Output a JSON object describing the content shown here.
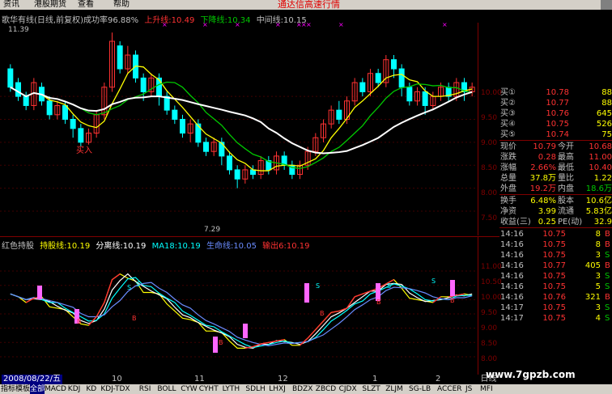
{
  "menu": {
    "items": [
      "资讯",
      "港股期货",
      "查看",
      "帮助"
    ],
    "brand": "通达信高速行情"
  },
  "main_chart": {
    "header": {
      "title": "歌华有线(日线,前复权)",
      "success_rate": "成功率96.88%",
      "up_line": "上升线:10.49",
      "down_line": "下降线:10.34",
      "mid_line": "中间线:10.15"
    },
    "high_label": "11.39",
    "low_label": "7.29",
    "buy_label": "买入",
    "y_ticks": [
      "10.00",
      "9.50",
      "9.00",
      "8.50",
      "8.00",
      "7.50"
    ],
    "colors": {
      "up": "#ff3232",
      "down": "#00ffff",
      "white": "#ffffff",
      "green": "#00c800",
      "yellow": "#ffff00"
    }
  },
  "chart_data": [
    {
      "type": "candlestick",
      "title": "歌华有线(日线,前复权)",
      "ylim": [
        7.2,
        11.5
      ],
      "series": [
        {
          "name": "上升线",
          "values": [
            10.49
          ]
        },
        {
          "name": "下降线",
          "values": [
            10.34
          ]
        },
        {
          "name": "中间线",
          "values": [
            10.15
          ]
        }
      ],
      "candles": [
        [
          10.6,
          10.2,
          10.7,
          10.1
        ],
        [
          10.3,
          10.0,
          10.4,
          9.9
        ],
        [
          10.0,
          9.8,
          10.1,
          9.7
        ],
        [
          9.8,
          10.3,
          10.4,
          9.7
        ],
        [
          10.2,
          9.9,
          10.3,
          9.8
        ],
        [
          9.9,
          9.6,
          10.0,
          9.5
        ],
        [
          9.6,
          9.8,
          9.9,
          9.5
        ],
        [
          9.8,
          9.5,
          9.9,
          9.4
        ],
        [
          9.5,
          9.3,
          9.6,
          9.1
        ],
        [
          9.3,
          9.0,
          9.4,
          8.9
        ],
        [
          9.0,
          9.2,
          9.3,
          8.95
        ],
        [
          9.2,
          9.6,
          9.7,
          9.1
        ],
        [
          9.6,
          10.2,
          10.3,
          9.5
        ],
        [
          10.2,
          11.2,
          11.39,
          10.1
        ],
        [
          11.1,
          10.6,
          11.2,
          10.5
        ],
        [
          10.6,
          10.9,
          11.1,
          10.5
        ],
        [
          10.9,
          10.4,
          11.0,
          10.3
        ],
        [
          10.4,
          10.1,
          10.5,
          9.9
        ],
        [
          10.1,
          10.4,
          10.5,
          10.0
        ],
        [
          10.4,
          10.0,
          10.5,
          9.8
        ],
        [
          10.0,
          9.7,
          10.1,
          9.6
        ],
        [
          9.7,
          9.5,
          9.8,
          9.4
        ],
        [
          9.5,
          9.2,
          9.6,
          9.1
        ],
        [
          9.2,
          9.4,
          9.5,
          9.0
        ],
        [
          9.4,
          9.0,
          9.5,
          8.9
        ],
        [
          9.0,
          8.8,
          9.1,
          8.7
        ],
        [
          8.8,
          9.0,
          9.1,
          8.7
        ],
        [
          9.0,
          8.7,
          9.1,
          8.5
        ],
        [
          8.7,
          8.4,
          8.8,
          8.3
        ],
        [
          8.4,
          8.2,
          8.5,
          8.0
        ],
        [
          8.2,
          8.4,
          8.5,
          8.1
        ],
        [
          8.4,
          8.3,
          8.5,
          8.2
        ],
        [
          8.3,
          8.6,
          8.7,
          8.2
        ],
        [
          8.6,
          8.4,
          8.7,
          8.3
        ],
        [
          8.4,
          8.7,
          8.8,
          8.3
        ],
        [
          8.7,
          8.5,
          8.8,
          8.4
        ],
        [
          8.5,
          8.3,
          8.6,
          8.2
        ],
        [
          8.3,
          8.5,
          8.6,
          8.2
        ],
        [
          8.5,
          8.8,
          8.9,
          8.4
        ],
        [
          8.8,
          9.1,
          9.2,
          8.7
        ],
        [
          9.1,
          9.4,
          9.5,
          9.0
        ],
        [
          9.4,
          9.7,
          9.8,
          9.3
        ],
        [
          9.7,
          9.5,
          9.9,
          9.4
        ],
        [
          9.5,
          9.9,
          10.0,
          9.4
        ],
        [
          9.9,
          10.3,
          10.4,
          9.8
        ],
        [
          10.3,
          10.1,
          10.4,
          10.0
        ],
        [
          10.1,
          10.5,
          10.6,
          10.0
        ],
        [
          10.5,
          10.3,
          10.6,
          10.2
        ],
        [
          10.3,
          10.8,
          10.9,
          10.2
        ],
        [
          10.8,
          10.6,
          10.9,
          10.4
        ],
        [
          10.6,
          10.2,
          10.7,
          10.0
        ],
        [
          10.2,
          9.9,
          10.3,
          9.8
        ],
        [
          9.9,
          10.1,
          10.2,
          9.8
        ],
        [
          10.1,
          9.8,
          10.2,
          9.6
        ],
        [
          9.8,
          10.0,
          10.1,
          9.7
        ],
        [
          10.0,
          10.2,
          10.3,
          9.9
        ],
        [
          10.2,
          10.0,
          10.3,
          9.9
        ],
        [
          10.0,
          10.3,
          10.4,
          9.9
        ],
        [
          10.3,
          10.1,
          10.4,
          9.9
        ],
        [
          10.1,
          10.2,
          10.3,
          10.0
        ]
      ]
    },
    {
      "type": "line",
      "title": "红色持股",
      "ylim": [
        7.8,
        11.2
      ],
      "series": [
        {
          "name": "持股线",
          "values": [
            10.19
          ]
        },
        {
          "name": "分离线",
          "values": [
            10.19
          ]
        },
        {
          "name": "MA18",
          "values": [
            10.19
          ]
        },
        {
          "name": "生命线",
          "values": [
            10.05
          ]
        },
        {
          "name": "输出6",
          "values": [
            10.19
          ]
        }
      ]
    }
  ],
  "sub_chart": {
    "header": {
      "title": "红色持股",
      "hold_line": "持股线:10.19",
      "split_line": "分离线:10.19",
      "ma18": "MA18:10.19",
      "life_line": "生命线:10.05",
      "output6": "输出6:10.19"
    },
    "y_ticks": [
      "11.00",
      "10.50",
      "10.00",
      "9.50",
      "9.00",
      "8.50",
      "8.00"
    ],
    "signal_b": "B",
    "signal_s": "S"
  },
  "panel": {
    "bids": [
      {
        "label": "买①",
        "price": "10.78",
        "vol": "88"
      },
      {
        "label": "买②",
        "price": "10.77",
        "vol": "88"
      },
      {
        "label": "买③",
        "price": "10.76",
        "vol": "645"
      },
      {
        "label": "买④",
        "price": "10.75",
        "vol": "526"
      },
      {
        "label": "买⑤",
        "price": "10.74",
        "vol": "75"
      }
    ],
    "quote": [
      {
        "l1": "现价",
        "v1": "10.79",
        "l2": "今开",
        "v2": "10.68"
      },
      {
        "l1": "涨跌",
        "v1": "0.28",
        "l2": "最高",
        "v2": "11.00"
      },
      {
        "l1": "涨幅",
        "v1": "2.66%",
        "l2": "最低",
        "v2": "10.40"
      },
      {
        "l1": "总量",
        "v1": "37.8万",
        "l2": "量比",
        "v2": "1.22"
      },
      {
        "l1": "外盘",
        "v1": "19.2万",
        "l2": "内盘",
        "v2": "18.6万"
      }
    ],
    "quote2": [
      {
        "l1": "换手",
        "v1": "6.48%",
        "l2": "股本",
        "v2": "10.6亿"
      },
      {
        "l1": "净资",
        "v1": "3.99",
        "l2": "流通",
        "v2": "5.83亿"
      },
      {
        "l1": "收益(三)",
        "v1": "0.25",
        "l2": "PE(动)",
        "v2": "32.9"
      }
    ],
    "ticks": [
      {
        "time": "14:16",
        "price": "10.75",
        "vol": "8",
        "bs": "B"
      },
      {
        "time": "14:16",
        "price": "10.75",
        "vol": "8",
        "bs": "B"
      },
      {
        "time": "14:16",
        "price": "10.75",
        "vol": "3",
        "bs": "S"
      },
      {
        "time": "14:16",
        "price": "10.77",
        "vol": "405",
        "bs": "B"
      },
      {
        "time": "14:16",
        "price": "10.75",
        "vol": "3",
        "bs": "S"
      },
      {
        "time": "14:16",
        "price": "10.75",
        "vol": "5",
        "bs": "S"
      },
      {
        "time": "14:16",
        "price": "10.76",
        "vol": "321",
        "bs": "B"
      },
      {
        "time": "14:17",
        "price": "10.75",
        "vol": "3",
        "bs": "S"
      },
      {
        "time": "14:17",
        "price": "10.75",
        "vol": "4",
        "bs": "S"
      }
    ]
  },
  "date_bar": {
    "date": "2008/08/22/五",
    "months": [
      "10",
      "11",
      "12",
      "1",
      "2"
    ],
    "period": "日线"
  },
  "tabs": [
    "指标",
    "模板",
    "全部",
    "MACD",
    "KDJ",
    "KD",
    "KDJ-TDX",
    "RSI",
    "BOLL",
    "CYW",
    "CYHT",
    "LYTH",
    "SDLH",
    "LHXJ",
    "BDZX",
    "ZBCD",
    "CJDX",
    "SLZT",
    "ZLJM",
    "SG-LB",
    "ACCER",
    "JS",
    "MFI"
  ],
  "watermark": "www.7gpzb.com"
}
